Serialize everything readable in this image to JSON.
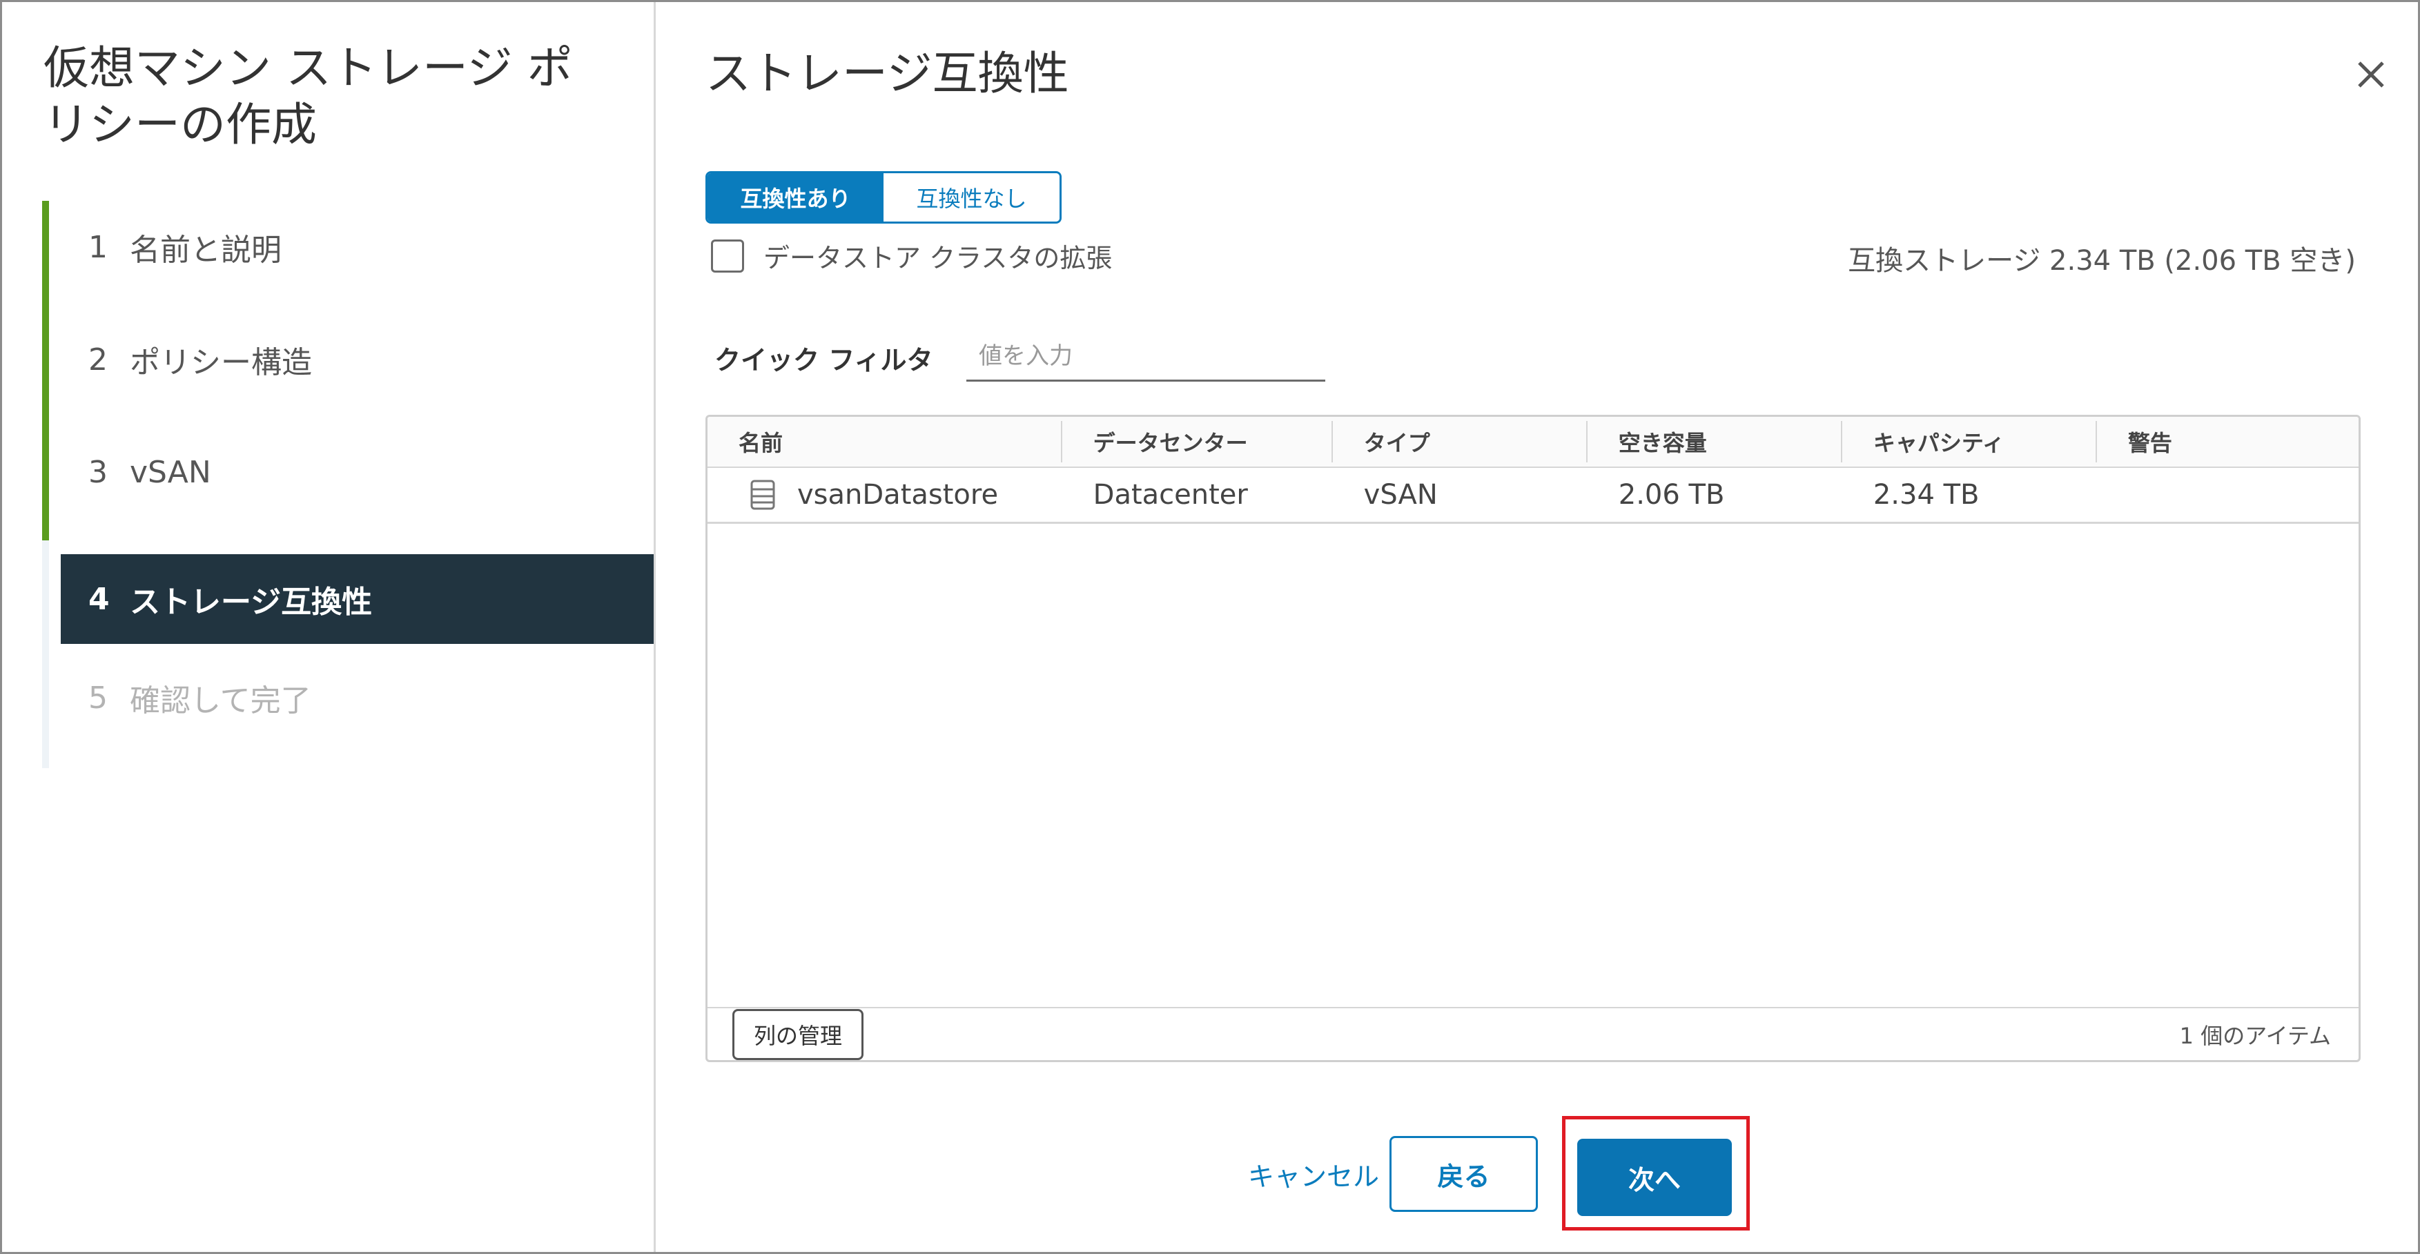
{
  "wizard": {
    "title": "仮想マシン ストレージ ポリシーの作成",
    "steps": [
      {
        "num": "1",
        "label": "名前と説明"
      },
      {
        "num": "2",
        "label": "ポリシー構造"
      },
      {
        "num": "3",
        "label": "vSAN"
      },
      {
        "num": "4",
        "label": "ストレージ互換性"
      },
      {
        "num": "5",
        "label": "確認して完了"
      }
    ]
  },
  "page": {
    "title": "ストレージ互換性",
    "close_icon": "close-icon",
    "toggle": {
      "compatible": "互換性あり",
      "incompatible": "互換性なし"
    },
    "expand_cluster_label": "データストア クラスタの拡張",
    "compatible_summary": "互換ストレージ 2.34 TB (2.06 TB 空き)",
    "quick_filter": {
      "label": "クイック フィルタ",
      "placeholder": "値を入力"
    }
  },
  "grid": {
    "columns": [
      "名前",
      "データセンター",
      "タイプ",
      "空き容量",
      "キャパシティ",
      "警告"
    ],
    "rows": [
      {
        "name": "vsanDatastore",
        "datacenter": "Datacenter",
        "type": "vSAN",
        "free": "2.06 TB",
        "capacity": "2.34 TB",
        "warning": "",
        "icon": "datastore-icon"
      }
    ],
    "manage_columns": "列の管理",
    "item_count": "1 個のアイテム"
  },
  "footer": {
    "cancel": "キャンセル",
    "back": "戻る",
    "next": "次へ"
  },
  "colors": {
    "accent": "#0a7cbd",
    "active_step_bg": "#213440",
    "step_progress": "#5a9c1e",
    "highlight_box": "#e01b24"
  }
}
